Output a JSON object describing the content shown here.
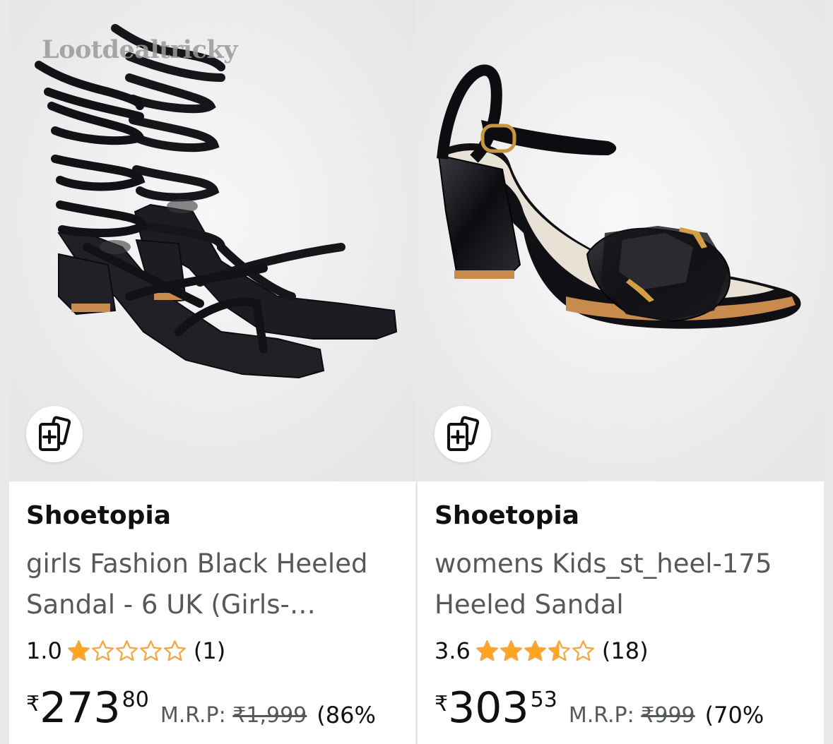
{
  "watermark": "Lootdealtricky",
  "products": [
    {
      "brand": "Shoetopia",
      "title_line1": "girls Fashion Black Heeled",
      "title_line2": "Sandal - 6 UK (Girls-…",
      "rating_value": "1.0",
      "rating_stars": 1.0,
      "rating_count": "(1)",
      "currency": "₹",
      "price_whole": "273",
      "price_fraction": "80",
      "mrp_label": "M.R.P:",
      "mrp_value": "₹1,999",
      "discount": "(86%",
      "image_icon": "lace-up-black-heeled-sandal",
      "compare_icon": "add-to-compare-icon"
    },
    {
      "brand": "Shoetopia",
      "title_line1": "womens Kids_st_heel-175",
      "title_line2": "Heeled Sandal",
      "rating_value": "3.6",
      "rating_stars": 3.5,
      "rating_count": "(18)",
      "currency": "₹",
      "price_whole": "303",
      "price_fraction": "53",
      "mrp_label": "M.R.P:",
      "mrp_value": "₹999",
      "discount": "(70%",
      "image_icon": "black-block-heel-sandal",
      "compare_icon": "add-to-compare-icon"
    }
  ],
  "colors": {
    "star": "#f3a847",
    "star_fill": "#ffa41c",
    "text_primary": "#0f1111",
    "text_secondary": "#565959",
    "image_bg": "#eeeeee"
  }
}
